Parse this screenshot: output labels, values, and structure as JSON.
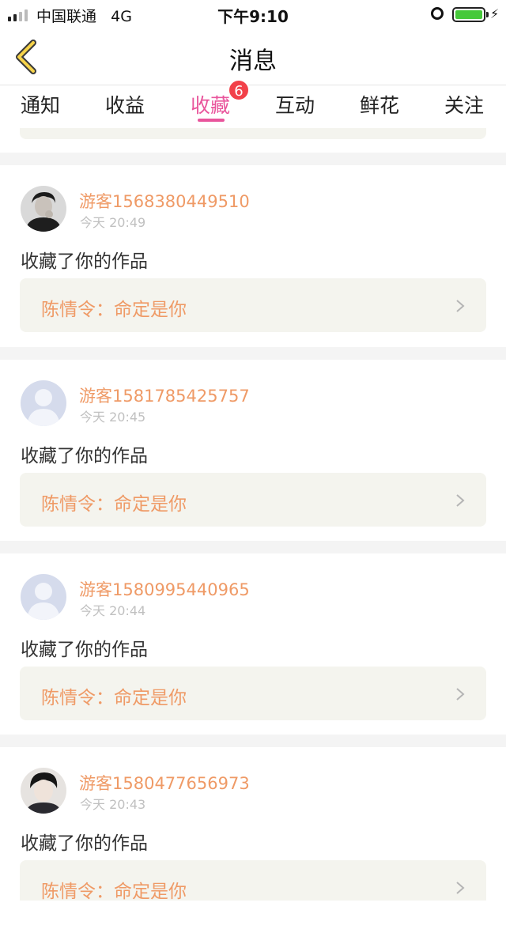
{
  "status_bar": {
    "carrier": "中国联通",
    "network": "4G",
    "time": "下午9:10"
  },
  "nav": {
    "title": "消息",
    "back_icon": "chevron-left-icon"
  },
  "tabs": [
    {
      "label": "通知",
      "active": false
    },
    {
      "label": "收益",
      "active": false
    },
    {
      "label": "收藏",
      "active": true,
      "badge": "6"
    },
    {
      "label": "互动",
      "active": false
    },
    {
      "label": "鲜花",
      "active": false
    },
    {
      "label": "关注",
      "active": false
    }
  ],
  "messages": [
    {
      "username": "游客1568380449510",
      "time": "今天 20:49",
      "action": "收藏了你的作品",
      "work_title": "陈情令：命定是你",
      "avatar": "photo-dark"
    },
    {
      "username": "游客1581785425757",
      "time": "今天 20:45",
      "action": "收藏了你的作品",
      "work_title": "陈情令：命定是你",
      "avatar": "default"
    },
    {
      "username": "游客1580995440965",
      "time": "今天 20:44",
      "action": "收藏了你的作品",
      "work_title": "陈情令：命定是你",
      "avatar": "default"
    },
    {
      "username": "游客1580477656973",
      "time": "今天 20:43",
      "action": "收藏了你的作品",
      "work_title": "陈情令：命定是你",
      "avatar": "photo-light"
    }
  ],
  "colors": {
    "accent": "#e9559c",
    "username": "#ef9a66",
    "badge": "#f24149",
    "battery": "#46c93a"
  }
}
